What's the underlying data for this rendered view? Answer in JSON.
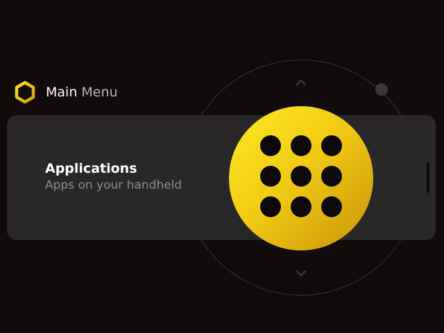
{
  "header": {
    "title_main": "Main",
    "title_sub": "Menu",
    "logo_icon": "hexagon-logo-icon"
  },
  "menu": {
    "selected_item": {
      "title": "Applications",
      "subtitle": "Apps on your handheld",
      "icon": "apps-grid-icon"
    }
  },
  "colors": {
    "background": "#110b0b",
    "card": "#292727",
    "accent": "#f5d41a",
    "accent_dark": "#c9940a"
  }
}
